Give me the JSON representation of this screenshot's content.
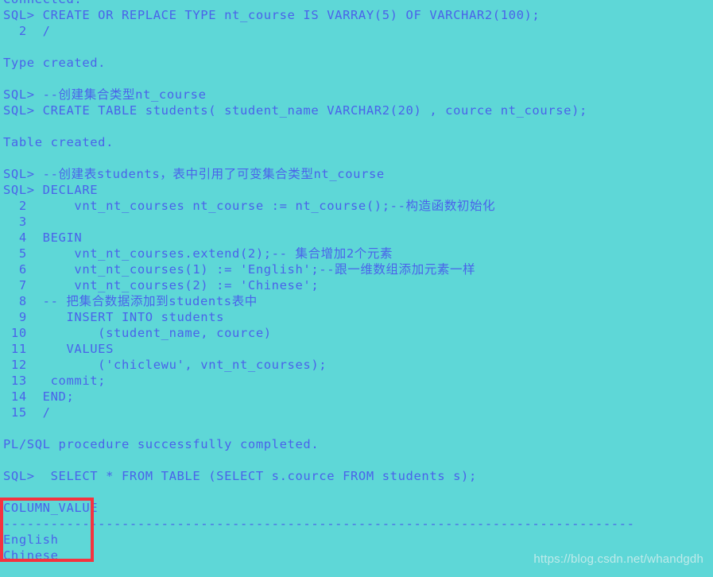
{
  "terminal": {
    "background_color": "#5ed7d7",
    "text_color": "#4a63ea",
    "highlight_color": "#f5333f",
    "lines": [
      {
        "id": "l00",
        "text": "Connected."
      },
      {
        "id": "l01",
        "text": "SQL> CREATE OR REPLACE TYPE nt_course IS VARRAY(5) OF VARCHAR2(100);"
      },
      {
        "id": "l02",
        "text": "  2  /"
      },
      {
        "id": "l03",
        "text": ""
      },
      {
        "id": "l04",
        "text": "Type created."
      },
      {
        "id": "l05",
        "text": ""
      },
      {
        "id": "l06",
        "text": "SQL> --创建集合类型nt_course"
      },
      {
        "id": "l07",
        "text": "SQL> CREATE TABLE students( student_name VARCHAR2(20) , cource nt_course);"
      },
      {
        "id": "l08",
        "text": ""
      },
      {
        "id": "l09",
        "text": "Table created."
      },
      {
        "id": "l10",
        "text": ""
      },
      {
        "id": "l11",
        "text": "SQL> --创建表students，表中引用了可变集合类型nt_course"
      },
      {
        "id": "l12",
        "text": "SQL> DECLARE"
      },
      {
        "id": "l13",
        "text": "  2      vnt_nt_courses nt_course := nt_course();--构造函数初始化"
      },
      {
        "id": "l14",
        "text": "  3"
      },
      {
        "id": "l15",
        "text": "  4  BEGIN"
      },
      {
        "id": "l16",
        "text": "  5      vnt_nt_courses.extend(2);-- 集合增加2个元素"
      },
      {
        "id": "l17",
        "text": "  6      vnt_nt_courses(1) := 'English';--跟一维数组添加元素一样"
      },
      {
        "id": "l18",
        "text": "  7      vnt_nt_courses(2) := 'Chinese';"
      },
      {
        "id": "l19",
        "text": "  8  -- 把集合数据添加到students表中"
      },
      {
        "id": "l20",
        "text": "  9     INSERT INTO students"
      },
      {
        "id": "l21",
        "text": " 10         (student_name, cource)"
      },
      {
        "id": "l22",
        "text": " 11     VALUES"
      },
      {
        "id": "l23",
        "text": " 12         ('chiclewu', vnt_nt_courses);"
      },
      {
        "id": "l24",
        "text": " 13   commit;"
      },
      {
        "id": "l25",
        "text": " 14  END;"
      },
      {
        "id": "l26",
        "text": " 15  /"
      },
      {
        "id": "l27",
        "text": ""
      },
      {
        "id": "l28",
        "text": "PL/SQL procedure successfully completed."
      },
      {
        "id": "l29",
        "text": ""
      },
      {
        "id": "l30",
        "text": "SQL>  SELECT * FROM TABLE (SELECT s.cource FROM students s);"
      },
      {
        "id": "l31",
        "text": ""
      },
      {
        "id": "l32",
        "text": "COLUMN_VALUE"
      },
      {
        "id": "l33",
        "text": "--------------------------------------------------------------------------------"
      },
      {
        "id": "l34",
        "text": "English"
      },
      {
        "id": "l35",
        "text": "Chinese"
      }
    ]
  },
  "result_table": {
    "columns": [
      "COLUMN_VALUE"
    ],
    "rows": [
      [
        "English"
      ],
      [
        "Chinese"
      ]
    ],
    "row_count": 2
  },
  "annotation": {
    "kind": "red-rectangle",
    "encloses": "COLUMN_VALUE column results: English, Chinese"
  },
  "watermark": {
    "text": "https://blog.csdn.net/whandgdh"
  }
}
